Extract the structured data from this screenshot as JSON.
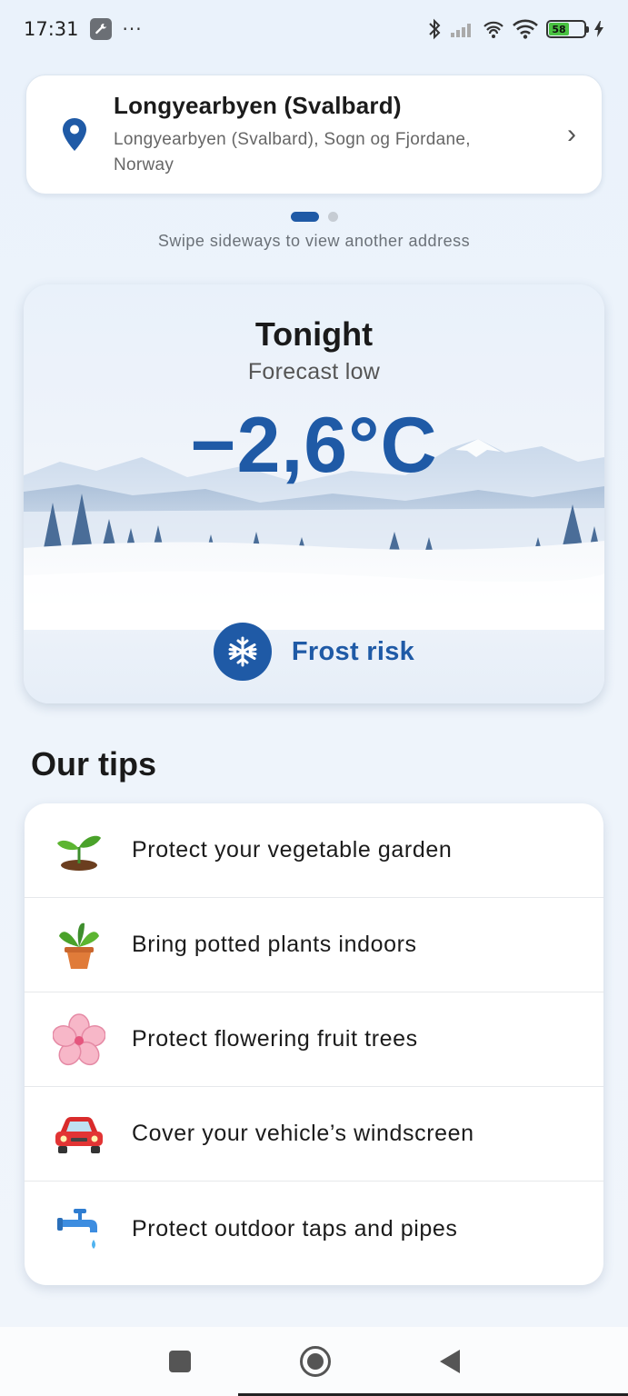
{
  "status_bar": {
    "time": "17:31",
    "more": "···",
    "battery_percent": "58",
    "battery_level": 0.58
  },
  "location": {
    "name": "Longyearbyen (Svalbard)",
    "detail": "Longyearbyen (Svalbard), Sogn og Fjordane, Norway",
    "chevron": "›"
  },
  "pager": {
    "hint": "Swipe sideways to view another address",
    "total": 2,
    "active": 1
  },
  "forecast": {
    "title": "Tonight",
    "subtitle": "Forecast low",
    "temperature": "−2,6°C",
    "risk_label": "Frost risk",
    "risk_icon": "snowflake-icon",
    "accent": "#1f5aa6"
  },
  "tips": {
    "heading": "Our tips",
    "items": [
      {
        "label": "Protect your vegetable garden",
        "icon": "seedling-icon"
      },
      {
        "label": "Bring potted plants indoors",
        "icon": "potted-plant-icon"
      },
      {
        "label": "Protect flowering fruit trees",
        "icon": "cherry-blossom-icon"
      },
      {
        "label": "Cover your vehicle’s windscreen",
        "icon": "car-icon"
      },
      {
        "label": "Protect outdoor taps and pipes",
        "icon": "water-tap-icon"
      }
    ]
  }
}
